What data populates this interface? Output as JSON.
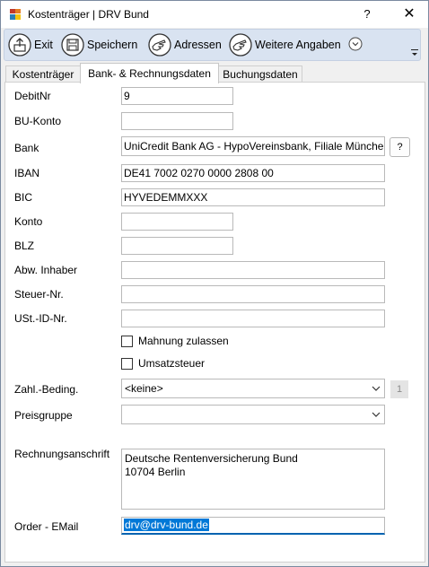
{
  "window": {
    "title": "Kostenträger | DRV Bund",
    "help_label": "?",
    "close_label": "✕"
  },
  "toolbar": {
    "exit_label": "Exit",
    "save_label": "Speichern",
    "addresses_label": "Adressen",
    "more_label": "Weitere Angaben",
    "more_icon": "chevron-down-circle-icon"
  },
  "tabs": [
    {
      "label": "Kostenträger",
      "active": false
    },
    {
      "label": "Bank- & Rechnungsdaten",
      "active": true
    },
    {
      "label": "Buchungsdaten",
      "active": false
    }
  ],
  "form": {
    "debit_nr": {
      "label": "DebitNr",
      "value": "9"
    },
    "bu_konto": {
      "label": "BU-Konto",
      "value": ""
    },
    "bank": {
      "label": "Bank",
      "value": "UniCredit Bank AG - HypoVereinsbank, Filiale Münche",
      "lookup_label": "?"
    },
    "iban": {
      "label": "IBAN",
      "value": "DE41 7002 0270 0000 2808 00"
    },
    "bic": {
      "label": "BIC",
      "value": "HYVEDEMMXXX"
    },
    "konto": {
      "label": "Konto",
      "value": ""
    },
    "blz": {
      "label": "BLZ",
      "value": ""
    },
    "abw_inhaber": {
      "label": "Abw. Inhaber",
      "value": ""
    },
    "steuer_nr": {
      "label": "Steuer-Nr.",
      "value": ""
    },
    "ust_id": {
      "label": "USt.-ID-Nr.",
      "value": ""
    },
    "mahnung": {
      "label": "Mahnung zulassen",
      "checked": false
    },
    "umsatzsteuer": {
      "label": "Umsatzsteuer",
      "checked": false
    },
    "zahl_beding": {
      "label": "Zahl.-Beding.",
      "value": "<keine>",
      "count": "1"
    },
    "preisgruppe": {
      "label": "Preisgruppe",
      "value": ""
    },
    "rechnungsanschrift": {
      "label": "Rechnungsanschrift",
      "value": "Deutsche Rentenversicherung Bund\n10704 Berlin"
    },
    "order_email": {
      "label": "Order - EMail",
      "value": "drv@drv-bund.de"
    }
  }
}
